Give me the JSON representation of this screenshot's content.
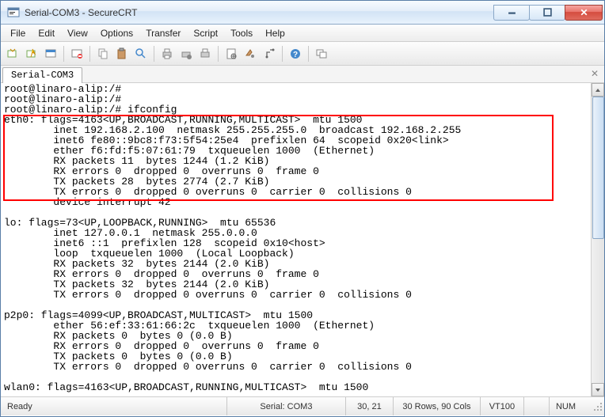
{
  "window": {
    "title": "Serial-COM3 - SecureCRT"
  },
  "menu": {
    "file": "File",
    "edit": "Edit",
    "view": "View",
    "options": "Options",
    "transfer": "Transfer",
    "script": "Script",
    "tools": "Tools",
    "help": "Help"
  },
  "tab": {
    "name": "Serial-COM3"
  },
  "terminal": {
    "lines": [
      "root@linaro-alip:/#",
      "root@linaro-alip:/#",
      "root@linaro-alip:/# ifconfig",
      "eth0: flags=4163<UP,BROADCAST,RUNNING,MULTICAST>  mtu 1500",
      "        inet 192.168.2.100  netmask 255.255.255.0  broadcast 192.168.2.255",
      "        inet6 fe80::9bc8:f73:5f54:25e4  prefixlen 64  scopeid 0x20<link>",
      "        ether f6:fd:f5:07:61:79  txqueuelen 1000  (Ethernet)",
      "        RX packets 11  bytes 1244 (1.2 KiB)",
      "        RX errors 0  dropped 0  overruns 0  frame 0",
      "        TX packets 28  bytes 2774 (2.7 KiB)",
      "        TX errors 0  dropped 0 overruns 0  carrier 0  collisions 0",
      "        device interrupt 42",
      "",
      "lo: flags=73<UP,LOOPBACK,RUNNING>  mtu 65536",
      "        inet 127.0.0.1  netmask 255.0.0.0",
      "        inet6 ::1  prefixlen 128  scopeid 0x10<host>",
      "        loop  txqueuelen 1000  (Local Loopback)",
      "        RX packets 32  bytes 2144 (2.0 KiB)",
      "        RX errors 0  dropped 0  overruns 0  frame 0",
      "        TX packets 32  bytes 2144 (2.0 KiB)",
      "        TX errors 0  dropped 0 overruns 0  carrier 0  collisions 0",
      "",
      "p2p0: flags=4099<UP,BROADCAST,MULTICAST>  mtu 1500",
      "        ether 56:ef:33:61:66:2c  txqueuelen 1000  (Ethernet)",
      "        RX packets 0  bytes 0 (0.0 B)",
      "        RX errors 0  dropped 0  overruns 0  frame 0",
      "        TX packets 0  bytes 0 (0.0 B)",
      "        TX errors 0  dropped 0 overruns 0  carrier 0  collisions 0",
      "",
      "wlan0: flags=4163<UP,BROADCAST,RUNNING,MULTICAST>  mtu 1500"
    ]
  },
  "status": {
    "ready": "Ready",
    "serial": "Serial: COM3",
    "cursor": "30, 21",
    "size": "30 Rows, 90 Cols",
    "term": "VT100",
    "caps": " ",
    "num": "NUM"
  }
}
